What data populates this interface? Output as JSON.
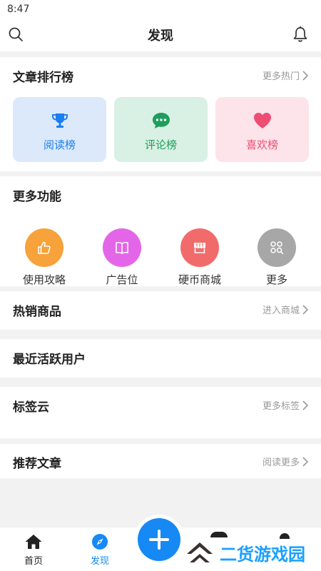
{
  "status": {
    "time": "8:47"
  },
  "header": {
    "title": "发现"
  },
  "ranking": {
    "title": "文章排行榜",
    "more": "更多热门",
    "items": [
      {
        "label": "阅读榜",
        "color": "#1a7ff0",
        "bg": "#dbe9fb",
        "icon": "trophy-icon"
      },
      {
        "label": "评论榜",
        "color": "#1e9e5a",
        "bg": "#d9f0e4",
        "icon": "comment-bubble-icon"
      },
      {
        "label": "喜欢榜",
        "color": "#ee4d74",
        "bg": "#fde3ea",
        "icon": "heart-icon"
      }
    ]
  },
  "functions": {
    "title": "更多功能",
    "items": [
      {
        "label": "使用攻略",
        "color": "#f7a23a",
        "icon": "thumbs-up-icon"
      },
      {
        "label": "广告位",
        "color": "#e466e8",
        "icon": "book-icon"
      },
      {
        "label": "硬币商城",
        "color": "#f26b6b",
        "icon": "store-icon"
      },
      {
        "label": "更多",
        "color": "#a7a7a7",
        "icon": "grid-search-icon"
      }
    ]
  },
  "hot_products": {
    "title": "热销商品",
    "more": "进入商城"
  },
  "active_users": {
    "title": "最近活跃用户"
  },
  "tag_cloud": {
    "title": "标签云",
    "more": "更多标签"
  },
  "recommended": {
    "title": "推荐文章",
    "more": "阅读更多"
  },
  "nav": {
    "home": "首页",
    "discover": "发现",
    "active_color": "#1689f5"
  },
  "watermark": {
    "text": "二货游戏园"
  }
}
